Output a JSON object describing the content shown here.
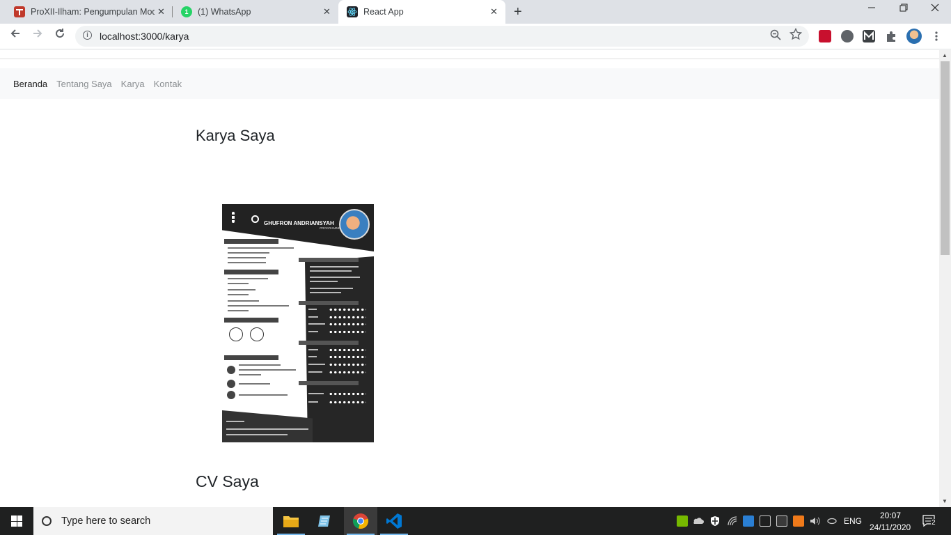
{
  "browser": {
    "tabs": [
      {
        "title": "ProXII-Ilham: Pengumpulan Mod",
        "favicon_color": "#c0392b"
      },
      {
        "title": "(1) WhatsApp",
        "favicon_color": "#25d366",
        "badge": "1"
      },
      {
        "title": "React App",
        "favicon_color": "#61dafb"
      }
    ],
    "close_glyph": "✕",
    "new_tab_glyph": "+",
    "url": "localhost:3000/karya"
  },
  "page": {
    "nav": [
      {
        "label": "Beranda"
      },
      {
        "label": "Tentang Saya"
      },
      {
        "label": "Karya"
      },
      {
        "label": "Kontak"
      }
    ],
    "heading_1": "Karya Saya",
    "heading_2": "CV Saya",
    "cv_image": {
      "name": "GHUFRON ANDRIANSYAH",
      "role": "PROGRAMMER"
    }
  },
  "taskbar": {
    "search_placeholder": "Type here to search",
    "language": "ENG",
    "time": "20:07",
    "date": "24/11/2020",
    "notification_count": "2"
  }
}
